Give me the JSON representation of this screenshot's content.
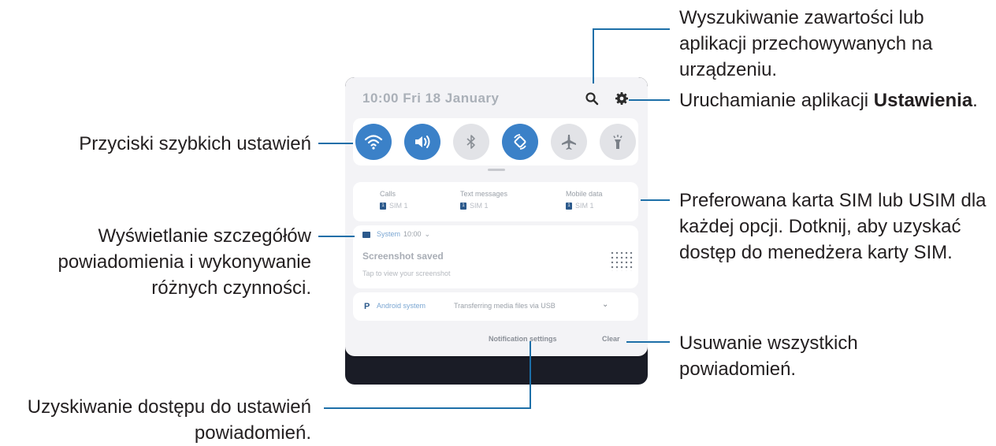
{
  "callouts": {
    "search_l1": "Wyszukiwanie zawartości lub",
    "search_l2": "aplikacji przechowywanych na",
    "search_l3": "urządzeniu.",
    "settings_prefix": "Uruchamianie aplikacji ",
    "settings_bold": "Ustawienia",
    "settings_suffix": ".",
    "quick_settings": "Przyciski szybkich ustawień",
    "details_l1": "Wyświetlanie szczegółów",
    "details_l2": "powiadomienia i wykonywanie",
    "details_l3": "różnych czynności.",
    "sim_l1": "Preferowana karta SIM lub USIM dla",
    "sim_l2": "każdej opcji. Dotknij, aby uzyskać",
    "sim_l3": "dostęp do menedżera karty SIM.",
    "clear_l1": "Usuwanie wszystkich",
    "clear_l2": "powiadomień.",
    "notif_settings_l1": "Uzyskiwanie dostępu do ustawień",
    "notif_settings_l2": "powiadomień."
  },
  "panel": {
    "status_text": "10:00  Fri 18 January",
    "quick_buttons": [
      {
        "name": "wifi",
        "state": "on"
      },
      {
        "name": "sound",
        "state": "on"
      },
      {
        "name": "bluetooth",
        "state": "off"
      },
      {
        "name": "auto-rotate",
        "state": "on"
      },
      {
        "name": "airplane",
        "state": "off"
      },
      {
        "name": "flashlight",
        "state": "off"
      }
    ],
    "sim": [
      {
        "label": "Calls",
        "sim": "SIM 1"
      },
      {
        "label": "Text messages",
        "sim": "SIM 1"
      },
      {
        "label": "Mobile data",
        "sim": "SIM 1"
      }
    ],
    "notification": {
      "app": "System",
      "time": "10:00",
      "title": "Screenshot saved",
      "subtitle": "Tap to view your screenshot"
    },
    "notification2": {
      "app": "Android system",
      "message": "Transferring media files via USB"
    },
    "footer": {
      "settings": "Notification settings",
      "clear": "Clear"
    }
  },
  "colors": {
    "accent": "#3b81c8",
    "callout_line": "#1d6fa8"
  }
}
